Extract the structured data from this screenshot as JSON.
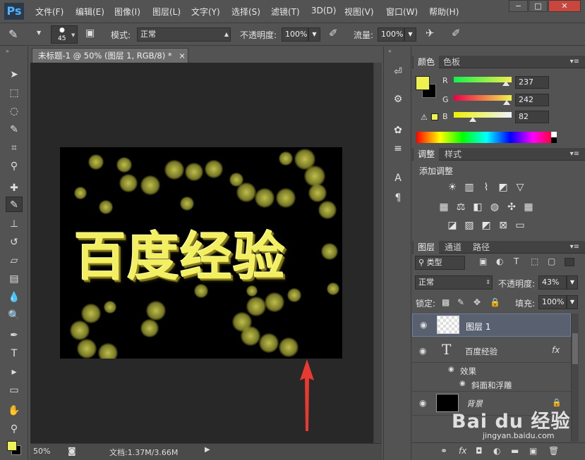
{
  "menubar": {
    "logo": "Ps",
    "items": [
      "文件(F)",
      "编辑(E)",
      "图像(I)",
      "图层(L)",
      "文字(Y)",
      "选择(S)",
      "滤镜(T)",
      "3D(D)",
      "视图(V)",
      "窗口(W)",
      "帮助(H)"
    ],
    "window_buttons": [
      "−",
      "□",
      "✕"
    ]
  },
  "options": {
    "brush_size": "45",
    "mode_label": "模式:",
    "mode_value": "正常",
    "opacity_label": "不透明度:",
    "opacity_value": "100%",
    "flow_label": "流量:",
    "flow_value": "100%"
  },
  "document": {
    "tab_title": "未标题-1 @ 50% (图层 1, RGB/8) *",
    "tab_close": "×",
    "artwork_text": "百度经验",
    "status_zoom": "50%",
    "status_doc": "文档:1.37M/3.66M"
  },
  "color_panel": {
    "tabs": [
      "颜色",
      "色板"
    ],
    "fg_color": "#edf252",
    "bg_color": "#000000",
    "channels": [
      {
        "label": "R",
        "value": "237"
      },
      {
        "label": "G",
        "value": "242"
      },
      {
        "label": "B",
        "value": "82"
      }
    ]
  },
  "adjust_panel": {
    "tabs": [
      "调整",
      "样式"
    ],
    "title": "添加调整"
  },
  "layers_panel": {
    "tabs": [
      "图层",
      "通道",
      "路径"
    ],
    "filter_value": "类型",
    "blend_value": "正常",
    "opacity_label": "不透明度:",
    "opacity_value": "43%",
    "lock_label": "锁定:",
    "fill_label": "填充:",
    "fill_value": "100%",
    "layers": [
      {
        "name": "图层 1"
      },
      {
        "name": "百度经验",
        "fx": "fx"
      },
      {
        "name": "效果"
      },
      {
        "name": "斜面和浮雕"
      },
      {
        "name": "背景"
      }
    ]
  },
  "watermark": {
    "brand": "Bai du 经验",
    "url": "jingyan.baidu.com"
  }
}
